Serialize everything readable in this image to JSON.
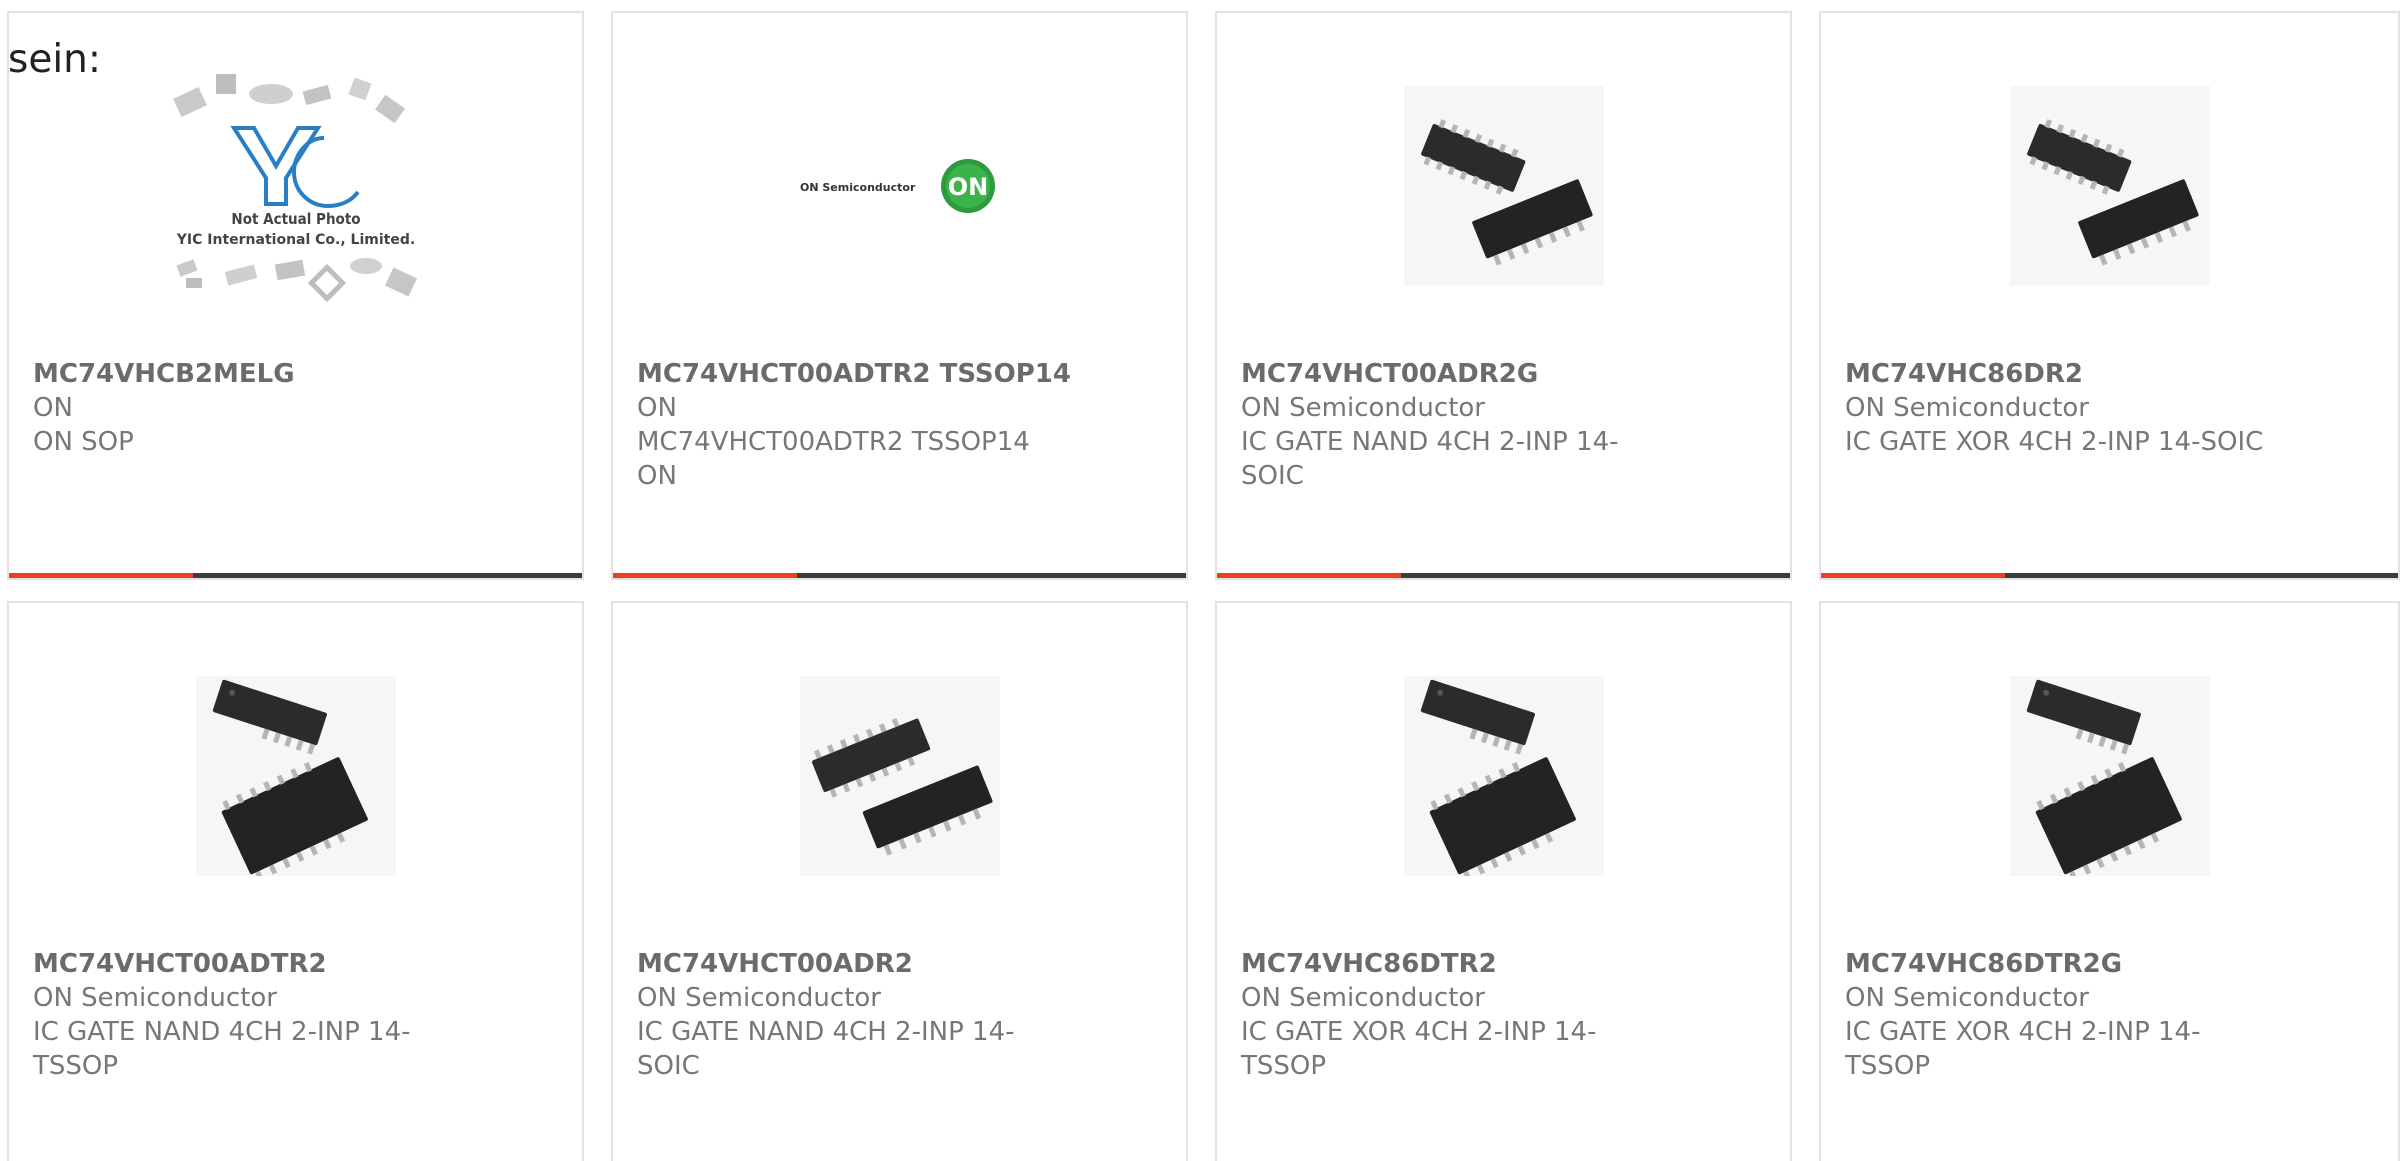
{
  "intro_text": "sein:",
  "colors": {
    "accent": "#e8441a",
    "bar": "#3b3b3b",
    "text": "#777777",
    "border": "#e2e2e2"
  },
  "cards": [
    {
      "part": "MC74VHCB2MELG",
      "lines": [
        "ON",
        "ON SOP"
      ],
      "image": "placeholder-photo",
      "image_caption": [
        "Not Actual Photo",
        "YIC International Co., Limited."
      ],
      "logo_text": "YIC"
    },
    {
      "part": "MC74VHCT00ADTR2 TSSOP14",
      "lines": [
        "ON",
        "MC74VHCT00ADTR2 TSSOP14",
        "ON"
      ],
      "image": "manufacturer-logo",
      "logo_label": "ON Semiconductor",
      "logo_badge": "ON"
    },
    {
      "part": "MC74VHCT00ADR2G",
      "lines": [
        "ON Semiconductor",
        "IC GATE NAND 4CH 2-INP 14-",
        "SOIC"
      ],
      "image": "soic-chip"
    },
    {
      "part": "MC74VHC86DR2",
      "lines": [
        "ON Semiconductor",
        "IC GATE XOR 4CH 2-INP 14-SOIC"
      ],
      "image": "soic-chip"
    },
    {
      "part": "MC74VHCT00ADTR2",
      "lines": [
        "ON Semiconductor",
        "IC GATE NAND 4CH 2-INP 14-",
        "TSSOP"
      ],
      "image": "tssop-chip"
    },
    {
      "part": "MC74VHCT00ADR2",
      "lines": [
        "ON Semiconductor",
        "IC GATE NAND 4CH 2-INP 14-",
        "SOIC"
      ],
      "image": "soic-chip"
    },
    {
      "part": "MC74VHC86DTR2",
      "lines": [
        "ON Semiconductor",
        "IC GATE XOR 4CH 2-INP 14-",
        "TSSOP"
      ],
      "image": "tssop-chip"
    },
    {
      "part": "MC74VHC86DTR2G",
      "lines": [
        "ON Semiconductor",
        "IC GATE XOR 4CH 2-INP 14-",
        "TSSOP"
      ],
      "image": "tssop-chip"
    }
  ]
}
